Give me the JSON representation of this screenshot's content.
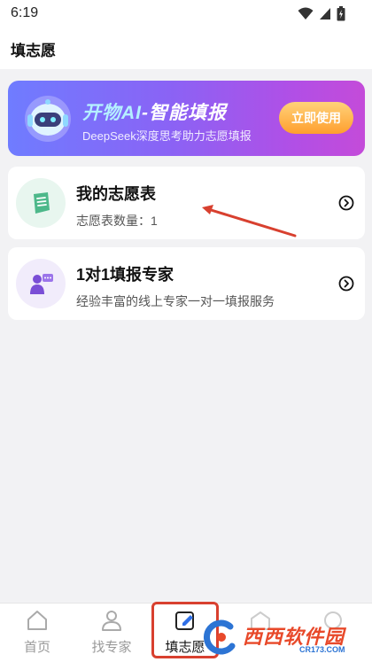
{
  "status_bar": {
    "time": "6:19"
  },
  "header": {
    "title": "填志愿"
  },
  "banner": {
    "title_prefix": "开物AI",
    "title_suffix": "-智能填报",
    "subtitle": "DeepSeek深度思考助力志愿填报",
    "button_label": "立即使用"
  },
  "cards": [
    {
      "title": "我的志愿表",
      "subtitle": "志愿表数量：1",
      "icon": "scroll-list-icon"
    },
    {
      "title": "1对1填报专家",
      "subtitle": "经验丰富的线上专家一对一填报服务",
      "icon": "expert-chat-icon"
    }
  ],
  "tabs": [
    {
      "label": "首页",
      "icon": "home-icon"
    },
    {
      "label": "找专家",
      "icon": "person-icon"
    },
    {
      "label": "填志愿",
      "icon": "edit-icon",
      "active": true
    }
  ],
  "watermark": {
    "text": "西西软件园",
    "sub": "CR173.COM"
  },
  "colors": {
    "accent_orange": "#ff9f2e",
    "annotation_red": "#d8402f",
    "banner_start": "#6f7cff",
    "banner_end": "#c44bd9"
  }
}
